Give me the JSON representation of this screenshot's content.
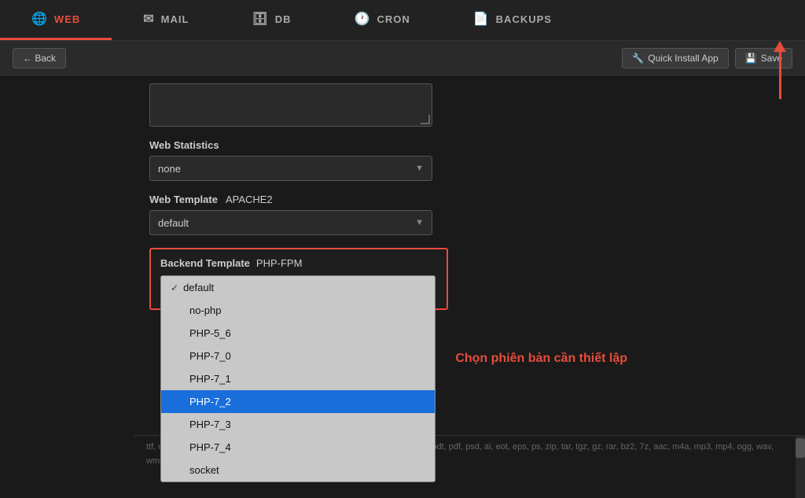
{
  "nav": {
    "tabs": [
      {
        "id": "web",
        "label": "WEB",
        "icon": "🌐",
        "active": true
      },
      {
        "id": "mail",
        "label": "MAIL",
        "icon": "✉",
        "active": false
      },
      {
        "id": "db",
        "label": "DB",
        "icon": "🗄",
        "active": false
      },
      {
        "id": "cron",
        "label": "CRON",
        "icon": "🕐",
        "active": false
      },
      {
        "id": "backups",
        "label": "BACKUPS",
        "icon": "📄",
        "active": false
      }
    ]
  },
  "toolbar": {
    "back_label": "← Back",
    "quick_install_label": "Quick Install App",
    "save_label": "Save"
  },
  "form": {
    "web_statistics_label": "Web Statistics",
    "web_statistics_value": "none",
    "web_template_label": "Web Template",
    "web_template_value": "APACHE2",
    "web_template_select": "default",
    "backend_template_label": "Backend Template",
    "backend_template_value": "PHP-FPM"
  },
  "dropdown": {
    "items": [
      {
        "id": "default",
        "label": "default",
        "checked": true,
        "selected": false
      },
      {
        "id": "no-php",
        "label": "no-php",
        "checked": false,
        "selected": false
      },
      {
        "id": "PHP-5_6",
        "label": "PHP-5_6",
        "checked": false,
        "selected": false
      },
      {
        "id": "PHP-7_0",
        "label": "PHP-7_0",
        "checked": false,
        "selected": false
      },
      {
        "id": "PHP-7_1",
        "label": "PHP-7_1",
        "checked": false,
        "selected": false
      },
      {
        "id": "PHP-7_2",
        "label": "PHP-7_2",
        "checked": false,
        "selected": true
      },
      {
        "id": "PHP-7_3",
        "label": "PHP-7_3",
        "checked": false,
        "selected": false
      },
      {
        "id": "PHP-7_4",
        "label": "PHP-7_4",
        "checked": false,
        "selected": false
      },
      {
        "id": "socket",
        "label": "socket",
        "checked": false,
        "selected": false
      }
    ]
  },
  "tooltip": {
    "text": "Chọn phiên bản cần thiết lập"
  },
  "bottom": {
    "text": "ttf, otf, webp, woff, txt, csv, rtf, doc, docx, xls, xlsx, ppt, pptx, odf, odp, ods, odt, pdf, psd, ai, eot, eps, ps, zip, tar, tgz, gz, rar, bz2, 7z, aac, m4a, mp3, mp4, ogg, wav, wma..."
  }
}
